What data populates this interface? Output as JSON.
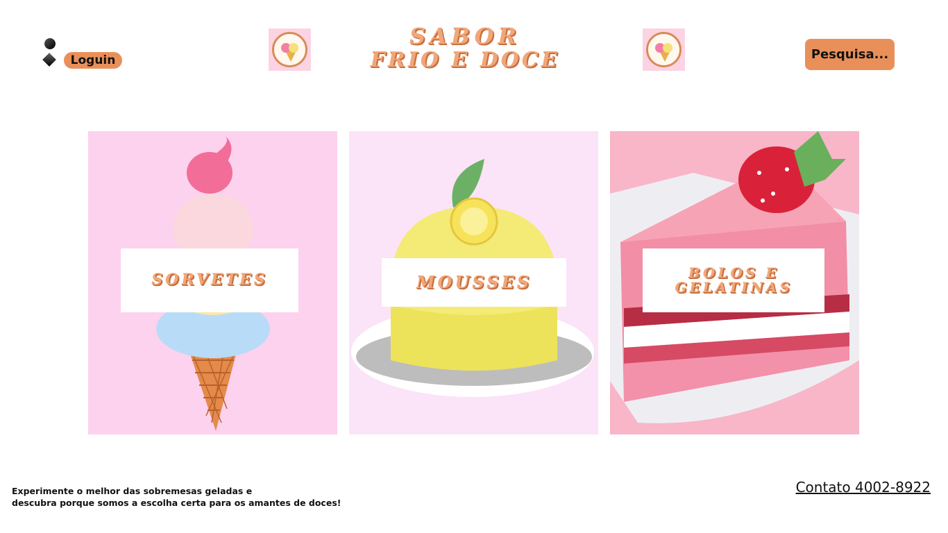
{
  "header": {
    "login_label": "Loguin",
    "brand_line1": "SABOR",
    "brand_line2": "FRIO E DOCE",
    "search_label": "Pesquisa..."
  },
  "categories": [
    {
      "label": "SORVETES",
      "bg": "#fcd2ee"
    },
    {
      "label": "MOUSSES",
      "bg": "#fbe3f8"
    },
    {
      "label": "BOLOS E GELATINAS",
      "bg": "#f8b6c8"
    }
  ],
  "footer": {
    "tagline_line1": "Experimente o melhor das sobremesas geladas e",
    "tagline_line2": "descubra porque somos a escolha certa para os amantes de doces!",
    "contact": "Contato 4002-8922"
  },
  "colors": {
    "accent": "#e9905a",
    "title": "#f0a77a"
  },
  "icons": [
    "user-icon",
    "logo-icon"
  ]
}
